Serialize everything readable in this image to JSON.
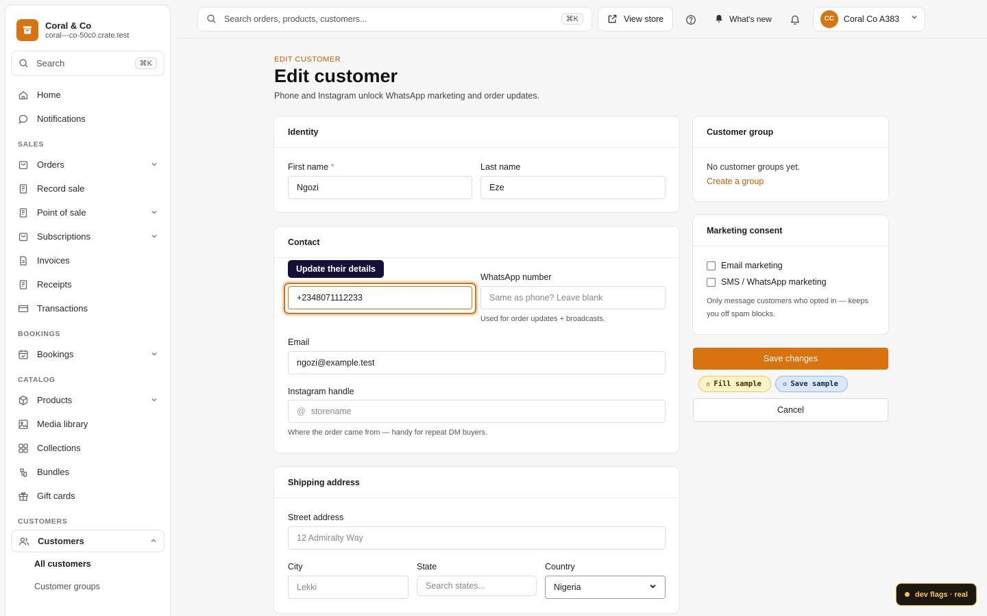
{
  "brand": {
    "name": "Coral & Co",
    "subdomain": "coral---co-50c0.crate.test"
  },
  "sidebar": {
    "search_label": "Search",
    "search_kbd": "⌘K",
    "items_top": [
      {
        "label": "Home",
        "icon": "home-icon"
      },
      {
        "label": "Notifications",
        "icon": "chat-bubble-icon"
      }
    ],
    "sales_heading": "SALES",
    "sales": [
      {
        "label": "Orders",
        "icon": "bag-icon",
        "expandable": true
      },
      {
        "label": "Record sale",
        "icon": "receipt-icon",
        "expandable": false
      },
      {
        "label": "Point of sale",
        "icon": "receipt-icon",
        "expandable": true
      },
      {
        "label": "Subscriptions",
        "icon": "bag-icon",
        "expandable": true
      },
      {
        "label": "Invoices",
        "icon": "document-icon",
        "expandable": false
      },
      {
        "label": "Receipts",
        "icon": "receipt-icon",
        "expandable": false
      },
      {
        "label": "Transactions",
        "icon": "card-icon",
        "expandable": false
      }
    ],
    "bookings_heading": "BOOKINGS",
    "bookings": [
      {
        "label": "Bookings",
        "icon": "calendar-icon",
        "expandable": true
      }
    ],
    "catalog_heading": "CATALOG",
    "catalog": [
      {
        "label": "Products",
        "icon": "box-icon",
        "expandable": true
      },
      {
        "label": "Media library",
        "icon": "image-icon",
        "expandable": false
      },
      {
        "label": "Collections",
        "icon": "grid-icon",
        "expandable": false
      },
      {
        "label": "Bundles",
        "icon": "bundle-icon",
        "expandable": false
      },
      {
        "label": "Gift cards",
        "icon": "gift-icon",
        "expandable": false
      }
    ],
    "customers_heading": "CUSTOMERS",
    "customers_label": "Customers",
    "customers_sub": [
      "All customers",
      "Customer groups"
    ]
  },
  "topbar": {
    "search_placeholder": "Search orders, products, customers...",
    "search_kbd": "⌘K",
    "view_store": "View store",
    "whats_new": "What's new",
    "account_initials": "CC",
    "account_name": "Coral Co A383"
  },
  "page": {
    "eyebrow": "EDIT CUSTOMER",
    "title": "Edit customer",
    "description": "Phone and Instagram unlock WhatsApp marketing and order updates."
  },
  "identity": {
    "heading": "Identity",
    "first_name_label": "First name",
    "required_mark": "*",
    "first_name": "Ngozi",
    "last_name_label": "Last name",
    "last_name": "Eze"
  },
  "contact": {
    "heading": "Contact",
    "tooltip": "Update their details",
    "phone": "+2348071112233",
    "whatsapp_label": "WhatsApp number",
    "whatsapp_placeholder": "Same as phone? Leave blank",
    "whatsapp_help": "Used for order updates + broadcasts.",
    "email_label": "Email",
    "email": "ngozi@example.test",
    "instagram_label": "Instagram handle",
    "instagram_prefix": "@",
    "instagram_placeholder": "storename",
    "instagram_help": "Where the order came from — handy for repeat DM buyers."
  },
  "shipping": {
    "heading": "Shipping address",
    "street_label": "Street address",
    "street_placeholder": "12 Admiralty Way",
    "city_label": "City",
    "city_placeholder": "Lekki",
    "state_label": "State",
    "state_placeholder": "Search states...",
    "country_label": "Country",
    "country": "Nigeria"
  },
  "customer_group": {
    "heading": "Customer group",
    "empty": "No customer groups yet.",
    "create_link": "Create a group"
  },
  "marketing": {
    "heading": "Marketing consent",
    "email_option": "Email marketing",
    "email_checked": false,
    "sms_option": "SMS / WhatsApp marketing",
    "sms_checked": false,
    "note": "Only message customers who opted in — keeps you off spam blocks."
  },
  "actions": {
    "save": "Save changes",
    "fill_sample": "Fill sample",
    "save_sample": "Save sample",
    "cancel": "Cancel"
  },
  "dev_flags": "dev flags · real",
  "colors": {
    "accent": "#d9730d",
    "tooltip_bg": "#15103a"
  }
}
